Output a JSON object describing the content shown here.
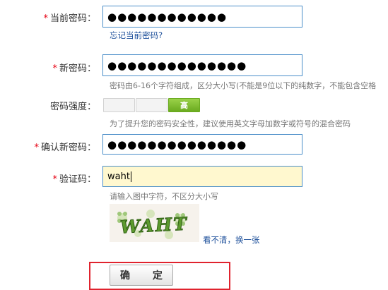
{
  "form": {
    "current_password": {
      "label": "当前密码：",
      "value": "●●●●●●●●●●●●",
      "forgot_link": "忘记当前密码?"
    },
    "new_password": {
      "label": "新密码：",
      "value": "●●●●●●●●●●●●●●",
      "hint": "密码由6-16个字符组成，区分大小写(不能是9位以下的纯数字，不能包含空格"
    },
    "strength": {
      "label": "密码强度：",
      "level_text": "高",
      "hint": "为了提升您的密码安全性，建议使用英文字母加数字或符号的混合密码"
    },
    "confirm_password": {
      "label": "确认新密码：",
      "value": "●●●●●●●●●●●●●●"
    },
    "captcha": {
      "label": "验证码：",
      "value": "waht",
      "hint": "请输入图中字符，不区分大小写",
      "image_text": "WAHT",
      "refresh_link": "看不清，换一张"
    },
    "submit_label": "确 定",
    "required_mark": "*"
  },
  "colors": {
    "required": "#e60012",
    "input_border": "#4a8ec9",
    "link": "#1a4d99",
    "strength_high": "#7cbf2e",
    "highlight": "#e0232e"
  }
}
